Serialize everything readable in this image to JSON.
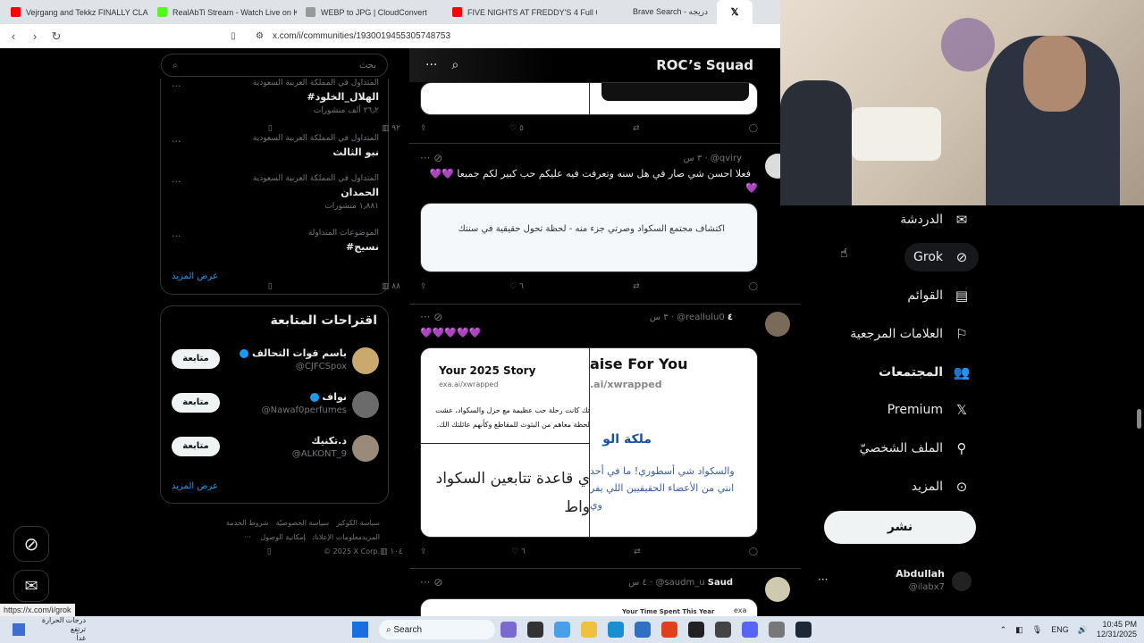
{
  "browser": {
    "tabs": [
      {
        "label": "Vejrgang and Tekkz FINALLY CLASH",
        "color": "#ff0000"
      },
      {
        "label": "RealAbTi Stream - Watch Live on Kick",
        "color": "#53fc18"
      },
      {
        "label": "WEBP to JPG | CloudConvert",
        "color": "#999999"
      },
      {
        "label": "",
        "color": "#ff6b6b"
      },
      {
        "label": "FIVE NIGHTS AT FREDDY'S 4 Full Gam",
        "color": "#ff0000"
      },
      {
        "label": "",
        "color": "#ff6b6b"
      },
      {
        "label": "Brave Search - دريجه",
        "color": "#ffffff"
      },
      {
        "label": "",
        "color": "#000000"
      }
    ],
    "url": "x.com/i/communities/1930019455305748753",
    "status_url": "https://x.com/i/grok"
  },
  "search": {
    "placeholder": "بحث"
  },
  "trends": [
    {
      "context": "المتداول في المملكة العربية السعودية",
      "name": "#الهلال_الخلود",
      "count": "٢٦٫٢ ألف منشورات"
    },
    {
      "context": "المتداول في المملكة العربية السعودية",
      "name": "نبو الثالث",
      "count": ""
    },
    {
      "context": "المتداول في المملكة العربية السعودية",
      "name": "الحمدان",
      "count": "١٫٨٨١ منشورات"
    },
    {
      "context": "الموضوعات المتداولة",
      "name": "#نسيج",
      "count": ""
    }
  ],
  "trends_show_more": "عرض المزيد",
  "follow": {
    "title": "اقتراحات المتابعة",
    "users": [
      {
        "name": "باسم قوات التحالف",
        "handle": "@CJFCSpox",
        "button": "متابعة"
      },
      {
        "name": "نواف",
        "handle": "@Nawaf0perfumes",
        "button": "متابعة"
      },
      {
        "name": "د.تكنيك",
        "handle": "@ALKONT_9",
        "button": "متابعة"
      }
    ],
    "show_more": "عرض المزيد"
  },
  "footer": {
    "line1": [
      "شروط الخدمة",
      "سياسة الخصوصيّة",
      "سياسة الكوكيز"
    ],
    "line2": [
      "إمكانية الوصول",
      "معلومات الإعلانات",
      "··· المزيد"
    ],
    "copyright": "© 2025 X Corp."
  },
  "feed": {
    "title": "ROC’s Squad",
    "tweet0_actions": {
      "views": "٩٢",
      "likes": "٥"
    },
    "tweet1": {
      "user": "@qviry",
      "time": "٣ س",
      "text": "فعلا احسن شي صار في هل سنه وتعرفت فيه عليكم حب كبير لكم جميعا 💜💜",
      "emoji_tail": "💜",
      "card_text": "اكتشاف مجتمع السكواد وصرتي جزء منه - لحظة تحول حقيقية في سنتك",
      "views": "٨٨",
      "likes": "٦"
    },
    "tweet2": {
      "user": "@reallulu0",
      "name": "٤",
      "time": "٣ س",
      "text": "💜💜💜💜💜",
      "story_title": "Your 2025 Story",
      "story_url": "exa.ai/xwrapped",
      "story_ar1": "تك كانت رحلة حب عظيمة مع جزل والسكواد، عشت",
      "story_ar2": "لحظة معاهم من البثوث للمقاطع وكأنهم عائلتك الك.",
      "big_ar1": "ي قاعدة تتابعين السكواد",
      "big_ar2": "واط",
      "praise_title": "aise For You",
      "praise_url": ".ai/xwrapped",
      "praise_ar_title": "ملكة الو",
      "praise_ar1": "والسكواد شي أسطوري! ما في أحد",
      "praise_ar2": "انتي من الأعضاء الحقيقيين اللي يفر",
      "praise_ar3": "وي",
      "views": "١٠٤",
      "likes": "٦"
    },
    "tweet3": {
      "name": "Saud",
      "user": "@saudm_u",
      "time": "٤ س",
      "card_text": "Your Time Spent This Year",
      "card_tag": "exa"
    }
  },
  "nav": {
    "items": [
      {
        "label": "الدردشة",
        "icon": "mail-icon"
      },
      {
        "label": "Grok",
        "icon": "grok-icon"
      },
      {
        "label": "القوائم",
        "icon": "list-icon"
      },
      {
        "label": "العلامات المرجعية",
        "icon": "bookmark-icon"
      },
      {
        "label": "المجتمعات",
        "icon": "communities-icon"
      },
      {
        "label": "Premium",
        "icon": "x-logo-icon"
      },
      {
        "label": "الملف الشخصيّ",
        "icon": "profile-icon"
      },
      {
        "label": "المزيد",
        "icon": "more-icon"
      }
    ],
    "post_button": "نشر",
    "account": {
      "name": "Abdullah",
      "handle": "@ilabx7"
    }
  },
  "taskbar": {
    "weather_line1": "درجات الحرارة ترتفع",
    "weather_line2": "غداً",
    "search": "Search",
    "lang": "ENG",
    "time": "10:45 PM",
    "date": "12/31/2025"
  }
}
